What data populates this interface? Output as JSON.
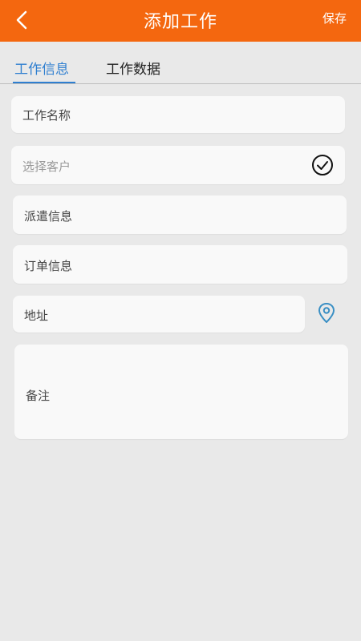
{
  "header": {
    "title": "添加工作",
    "save_label": "保存",
    "back_icon": "chevron-left-icon",
    "bg_color": "#f4670f"
  },
  "tabs": [
    {
      "label": "工作信息",
      "active": true
    },
    {
      "label": "工作数据",
      "active": false
    }
  ],
  "form": {
    "job_name_label": "工作名称",
    "select_customer_placeholder": "选择客户",
    "dispatch_info_label": "派遣信息",
    "order_info_label": "订单信息",
    "address_label": "地址",
    "notes_label": "备注"
  },
  "icons": {
    "customer_select": "check-circle-icon",
    "address": "location-pin-icon"
  },
  "colors": {
    "accent_blue": "#2f7fd0",
    "header_orange": "#f4670f"
  }
}
